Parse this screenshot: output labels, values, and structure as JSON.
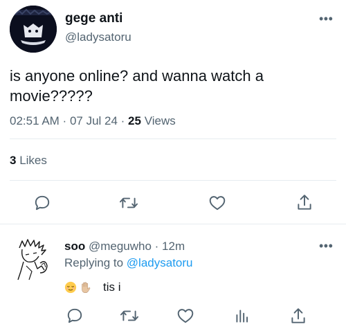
{
  "tweet": {
    "display_name": "gege anti",
    "handle": "@ladysatoru",
    "text": "is anyone online? and wanna watch a movie?????",
    "time": "02:51 AM",
    "date": "07 Jul 24",
    "views_count": "25",
    "views_label": "Views",
    "likes_count": "3",
    "likes_label": "Likes",
    "more_label": "•••"
  },
  "reply": {
    "name": "soo",
    "handle": "@meguwho",
    "time": "12m",
    "replying_label": "Replying to",
    "replying_handle": "@ladysatoru",
    "text": "tis i",
    "more_label": "•••"
  },
  "icons": {
    "main_actions": [
      "reply-icon",
      "retweet-icon",
      "like-icon",
      "share-icon"
    ],
    "reply_actions": [
      "reply-icon",
      "retweet-icon",
      "like-icon",
      "analytics-icon",
      "share-icon"
    ],
    "emojis": [
      "relieved-face-emoji",
      "raised-hand-emoji"
    ]
  },
  "colors": {
    "text": "#0f1419",
    "secondary": "#536471",
    "link": "#1d9bf0",
    "divider": "#e6ecf0"
  }
}
